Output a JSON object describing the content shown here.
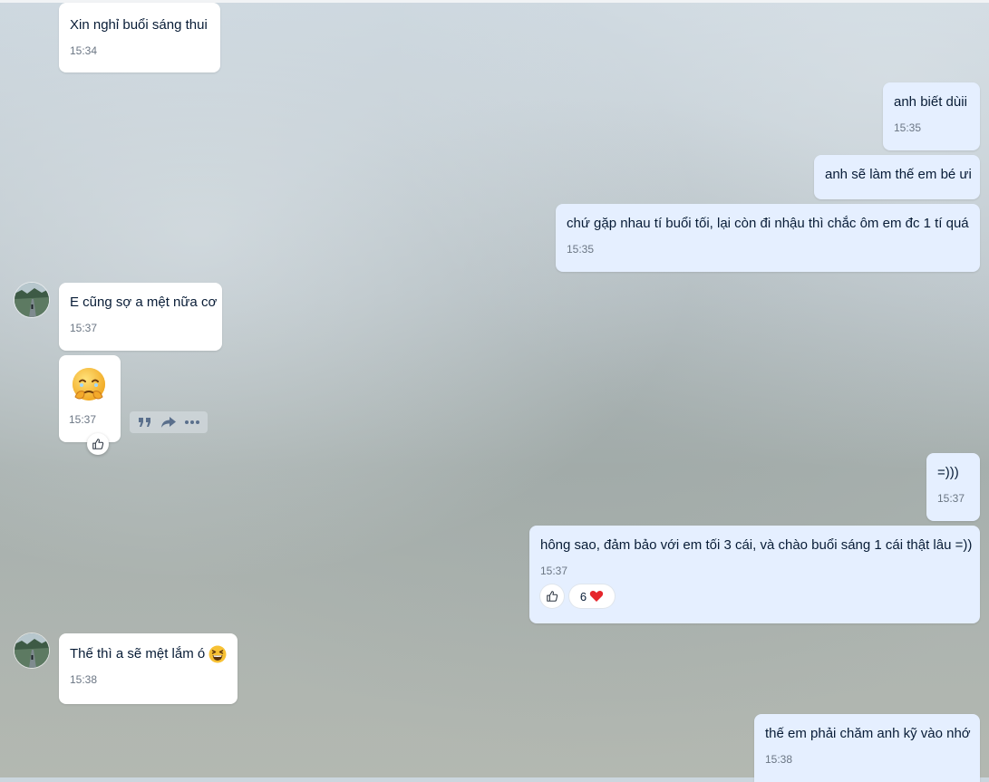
{
  "messages": [
    {
      "text": "Xin nghỉ buổi sáng thui",
      "time": "15:34"
    },
    {
      "text": "anh biết dùii",
      "time": "15:35"
    },
    {
      "text": "anh sẽ làm thế em bé ưi"
    },
    {
      "text": "chứ gặp nhau tí buổi tối, lại còn đi nhậu thì chắc ôm em đc 1 tí quá",
      "time": "15:35"
    },
    {
      "text": "E cũng sợ a mệt nữa cơ",
      "time": "15:37"
    },
    {
      "sticker": "face-holding-back-tears-emoji",
      "time": "15:37"
    },
    {
      "text": "=)))",
      "time": "15:37"
    },
    {
      "text": "hông sao, đảm bảo với em tối 3 cái, và chào buổi sáng 1 cái thật lâu =))",
      "time": "15:37",
      "reaction_count": "6",
      "reaction_emoji": "❤️"
    },
    {
      "text": "Thế thì a sẽ mệt lắm ó",
      "emoji": "😆",
      "time": "15:38"
    },
    {
      "text": "thế em phải chăm anh kỹ vào nhớ",
      "time": "15:38"
    }
  ],
  "icons": {
    "like": "thumbs-up-icon",
    "quote": "quote-icon",
    "forward": "forward-icon",
    "more": "more-icon"
  },
  "colors": {
    "incoming_bubble": "#ffffff",
    "outgoing_bubble": "#e5efff",
    "text": "#081c36",
    "time": "#6b7684"
  }
}
